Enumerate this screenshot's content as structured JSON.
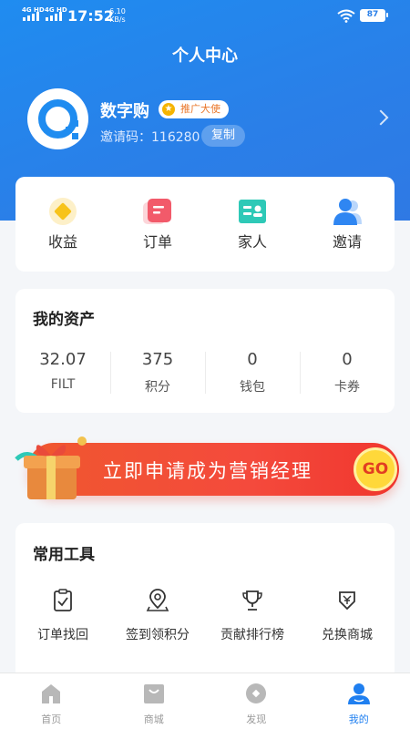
{
  "status_bar": {
    "net1": "4G HD",
    "net2": "4G HD",
    "time": "17:52",
    "speed_value": "6.10",
    "speed_unit": "KB/s",
    "battery": "87"
  },
  "header": {
    "title": "个人中心"
  },
  "profile": {
    "name": "数字购",
    "badge": "推广大使",
    "invite_code": "邀请码：116280",
    "copy_label": "复制"
  },
  "quick_actions": [
    {
      "label": "收益",
      "icon": "earnings-icon",
      "color": "#f7c31a"
    },
    {
      "label": "订单",
      "icon": "order-icon",
      "color": "#f25a6a"
    },
    {
      "label": "家人",
      "icon": "family-icon",
      "color": "#2ec9b7"
    },
    {
      "label": "邀请",
      "icon": "invite-icon",
      "color": "#2f86f2"
    }
  ],
  "assets": {
    "title": "我的资产",
    "items": [
      {
        "value": "32.07",
        "unit": "FILT"
      },
      {
        "value": "375",
        "unit": "积分"
      },
      {
        "value": "0",
        "unit": "钱包"
      },
      {
        "value": "0",
        "unit": "卡券"
      }
    ]
  },
  "banner": {
    "text": "立即申请成为营销经理",
    "go": "GO"
  },
  "tools": {
    "title": "常用工具",
    "items": [
      {
        "label": "订单找回",
        "icon": "clipboard-check-icon"
      },
      {
        "label": "签到领积分",
        "icon": "location-pin-icon"
      },
      {
        "label": "贡献排行榜",
        "icon": "trophy-icon"
      },
      {
        "label": "兑换商城",
        "icon": "exchange-bag-icon"
      }
    ]
  },
  "tabbar": [
    {
      "label": "首页",
      "icon": "home-icon"
    },
    {
      "label": "商城",
      "icon": "store-icon"
    },
    {
      "label": "发现",
      "icon": "discover-icon"
    },
    {
      "label": "我的",
      "icon": "profile-icon",
      "active": true
    }
  ],
  "colors": {
    "primary": "#1f8cf0",
    "banner_red": "#f44a3c",
    "tab_active": "#1f7ff0"
  }
}
